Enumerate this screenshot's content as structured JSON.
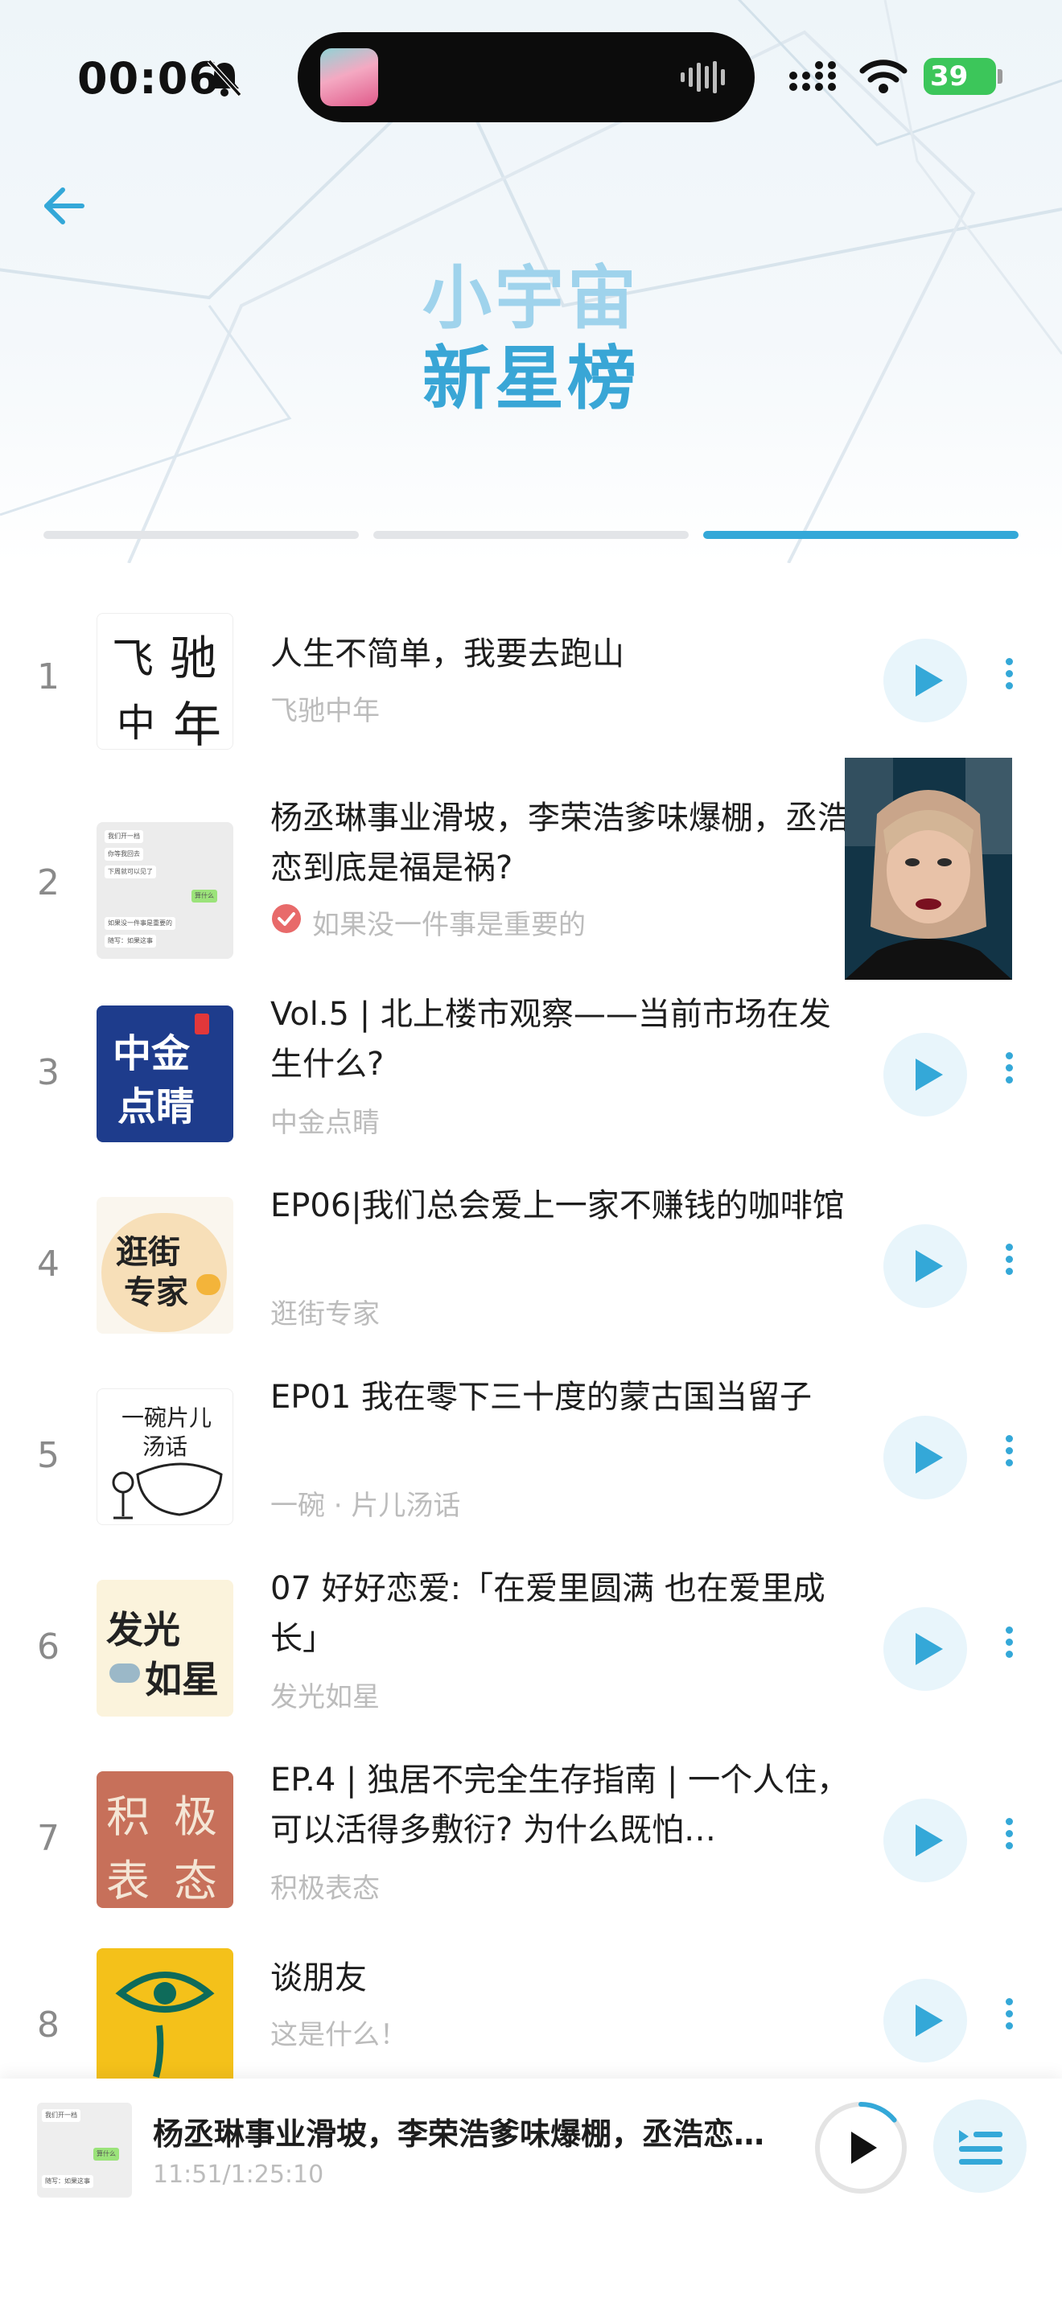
{
  "status": {
    "time": "00:06",
    "battery": "39"
  },
  "header": {
    "title_line1": "小宇宙",
    "title_line2": "新星榜"
  },
  "tabs": {
    "count": 3,
    "active_index": 2
  },
  "episodes": [
    {
      "rank": "1",
      "title": "人生不简单，我要去跑山",
      "podcast": "飞驰中年",
      "cover": "飞驰中年"
    },
    {
      "rank": "2",
      "title": "杨丞琳事业滑坡，李荣浩爹味爆棚，丞浩恋到底是福是祸?",
      "podcast": "如果没一件事是重要的",
      "cover": "chat"
    },
    {
      "rank": "3",
      "title": "Vol.5 | 北上楼市观察——当前市场在发生什么?",
      "podcast": "中金点睛",
      "cover": "中金点睛"
    },
    {
      "rank": "4",
      "title": "EP06|我们总会爱上一家不赚钱的咖啡馆",
      "podcast": "逛街专家",
      "cover": "逛街专家"
    },
    {
      "rank": "5",
      "title": "EP01 我在零下三十度的蒙古国当留子",
      "podcast": "一碗 · 片儿汤话",
      "cover": "一碗片儿汤话"
    },
    {
      "rank": "6",
      "title": "07 好好恋爱:「在爱里圆满 也在爱里成长」",
      "podcast": "发光如星",
      "cover": "发光如星"
    },
    {
      "rank": "7",
      "title": "EP.4 | 独居不完全生存指南 | 一个人住，可以活得多敷衍? 为什么既怕…",
      "podcast": "积极表态",
      "cover": "积极表态"
    },
    {
      "rank": "8",
      "title": "谈朋友",
      "podcast": "这是什么！",
      "cover": "eye"
    }
  ],
  "covers": {
    "c1_a": "飞",
    "c1_b": "驰",
    "c1_c": "中",
    "c1_d": "年",
    "c3_a": "中金",
    "c3_b": "点睛",
    "c4_a": "逛街",
    "c4_b": "专家",
    "c5_a": "一碗片儿",
    "c5_b": "汤话",
    "c6_a": "发光",
    "c6_b": "如星",
    "c7_a": "积",
    "c7_b": "极",
    "c7_c": "表",
    "c7_d": "态",
    "chat": [
      "我们开一档",
      "你等我回去",
      "下周就可以见了",
      "算什么",
      "如果没一件事是重要的",
      "随写：如果这事"
    ]
  },
  "player": {
    "title": "杨丞琳事业滑坡，李荣浩爹味爆棚，丞浩恋…",
    "time": "11:51/1:25:10",
    "progress": 0.14
  },
  "colors": {
    "accent": "#34a8d8",
    "title_light": "#9fd3ec",
    "subtext": "#bcbcbc"
  }
}
